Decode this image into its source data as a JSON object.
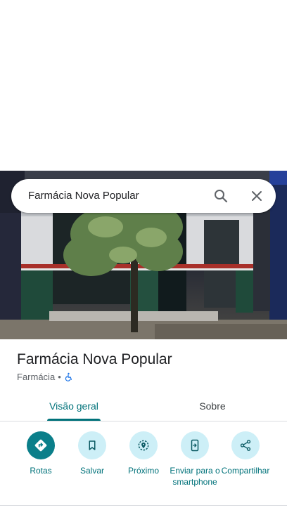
{
  "search": {
    "query": "Farmácia Nova Popular",
    "search_icon": "search-icon",
    "close_icon": "close-icon"
  },
  "place": {
    "name": "Farmácia Nova Popular",
    "category": "Farmácia",
    "separator": "•",
    "accessibility_icon": "wheelchair-icon"
  },
  "tabs": [
    {
      "label": "Visão geral",
      "active": true
    },
    {
      "label": "Sobre",
      "active": false
    }
  ],
  "actions": [
    {
      "label": "Rotas",
      "icon": "directions-icon"
    },
    {
      "label": "Salvar",
      "icon": "bookmark-icon"
    },
    {
      "label": "Próximo",
      "icon": "nearby-icon"
    },
    {
      "label": "Enviar para o smartphone",
      "icon": "send-to-phone-icon"
    },
    {
      "label": "Compartilhar",
      "icon": "share-icon"
    }
  ],
  "colors": {
    "accent": "#00727a",
    "primary_button": "#0b7f8a",
    "chip_bg": "#cdeff7",
    "title": "#202124",
    "muted": "#5f6368"
  }
}
